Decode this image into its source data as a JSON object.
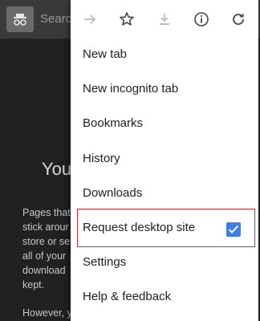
{
  "background": {
    "search_hint": "Searc",
    "heading": "You",
    "paragraph_lines": [
      "Pages that",
      "stick arour",
      "store or se",
      "all of your",
      "download",
      "kept."
    ],
    "paragraph2": "However, you aren't invisible. Using incognito"
  },
  "menu": {
    "icons": [
      "forward-arrow-icon",
      "star-icon",
      "download-icon",
      "info-icon",
      "refresh-icon"
    ],
    "items": [
      {
        "label": "New tab"
      },
      {
        "label": "New incognito tab"
      },
      {
        "label": "Bookmarks"
      },
      {
        "label": "History"
      },
      {
        "label": "Downloads"
      },
      {
        "label": "Request desktop site",
        "checked": true
      },
      {
        "label": "Settings"
      },
      {
        "label": "Help & feedback"
      }
    ]
  },
  "colors": {
    "highlight_border": "#d42a35",
    "checkbox": "#3f7fe5",
    "menu_bg": "#ffffff",
    "page_bg": "#212121"
  }
}
